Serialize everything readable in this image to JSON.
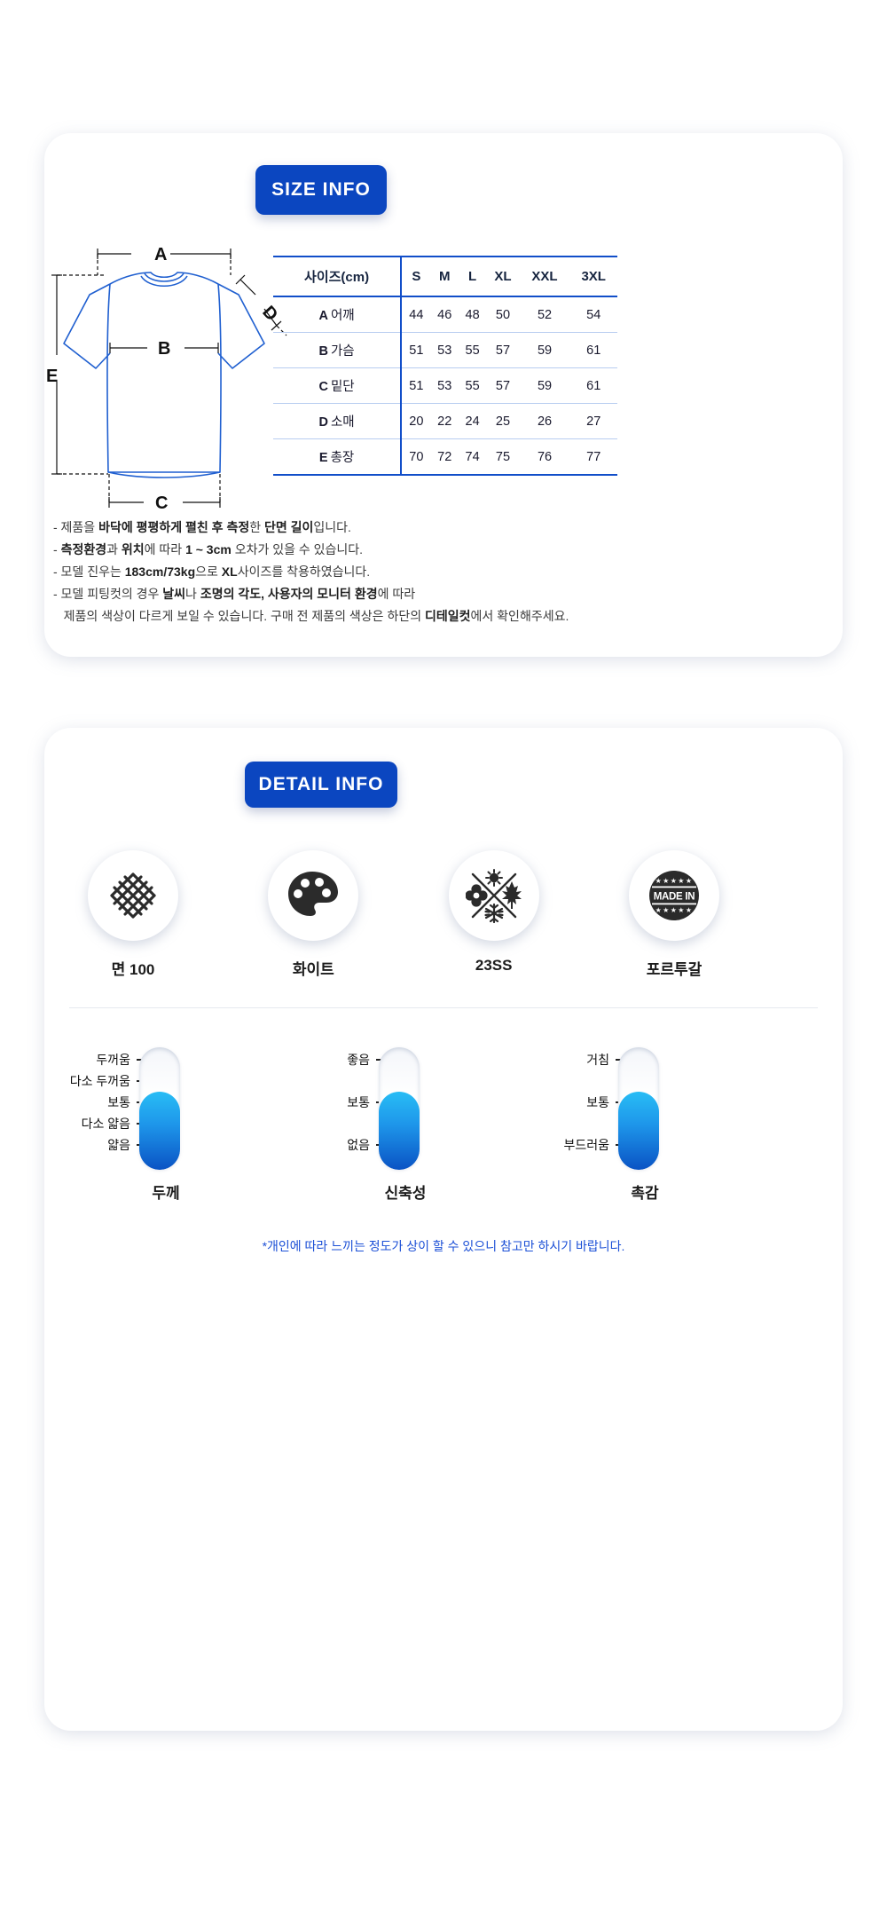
{
  "sections": {
    "size": {
      "badge": "SIZE INFO"
    },
    "detail": {
      "badge": "DETAIL INFO"
    }
  },
  "shirt_diagram": {
    "labels": {
      "a": "A",
      "b": "B",
      "c": "C",
      "d": "D",
      "e": "E"
    }
  },
  "size_table": {
    "corner_header": "사이즈(cm)",
    "columns": [
      "S",
      "M",
      "L",
      "XL",
      "XXL",
      "3XL"
    ],
    "rows": [
      {
        "key": "A",
        "name": "어깨",
        "values": [
          44,
          46,
          48,
          50,
          52,
          54
        ]
      },
      {
        "key": "B",
        "name": "가슴",
        "values": [
          51,
          53,
          55,
          57,
          59,
          61
        ]
      },
      {
        "key": "C",
        "name": "밑단",
        "values": [
          51,
          53,
          55,
          57,
          59,
          61
        ]
      },
      {
        "key": "D",
        "name": "소매",
        "values": [
          20,
          22,
          24,
          25,
          26,
          27
        ]
      },
      {
        "key": "E",
        "name": "총장",
        "values": [
          70,
          72,
          74,
          75,
          76,
          77
        ]
      }
    ]
  },
  "size_notes": [
    "- 제품을 바닥에 평평하게 펼친 후 측정한 단면 길이입니다.",
    "- 측정환경과 위치에 따라 1 ~ 3cm 오차가 있을 수 있습니다.",
    "- 모델 진우는 183cm/73kg으로 XL사이즈를 착용하였습니다.",
    "- 모델 피팅컷의 경우 날씨나 조명의 각도, 사용자의 모니터 환경에 따라\n   제품의 색상이 다르게 보일 수 있습니다. 구매 전 제품의 색상은 하단의 디테일컷에서 확인해주세요."
  ],
  "detail_icons": [
    {
      "icon": "woven-fabric-icon",
      "label": "면 100"
    },
    {
      "icon": "paint-palette-icon",
      "label": "화이트"
    },
    {
      "icon": "four-seasons-icon",
      "label": "23SS"
    },
    {
      "icon": "made-in-badge-icon",
      "label": "포르투갈",
      "badge_text": "MADE IN"
    }
  ],
  "gauges": [
    {
      "name": "두께",
      "ticks": [
        "두꺼움",
        "다소 두꺼움",
        "보통",
        "다소 얇음",
        "얇음"
      ],
      "fill_from_tick": 3,
      "fill_percent": 64
    },
    {
      "name": "신축성",
      "ticks": [
        "좋음",
        "보통",
        "없음"
      ],
      "fill_from_tick": 2,
      "fill_percent": 64
    },
    {
      "name": "촉감",
      "ticks": [
        "거침",
        "보통",
        "부드러움"
      ],
      "fill_from_tick": 2,
      "fill_percent": 64
    }
  ],
  "gauge_footnote": "*개인에 따라 느끼는 정도가 상이 할 수 있으니 참고만 하시기 바랍니다.",
  "colors": {
    "brand_blue": "#0B46C0",
    "table_line": "#114ec9",
    "diagram_blue": "#1f5fd0",
    "gauge_top": "#28bdf5",
    "gauge_bottom": "#0a53c4",
    "footnote_blue": "#1b4fd6"
  }
}
